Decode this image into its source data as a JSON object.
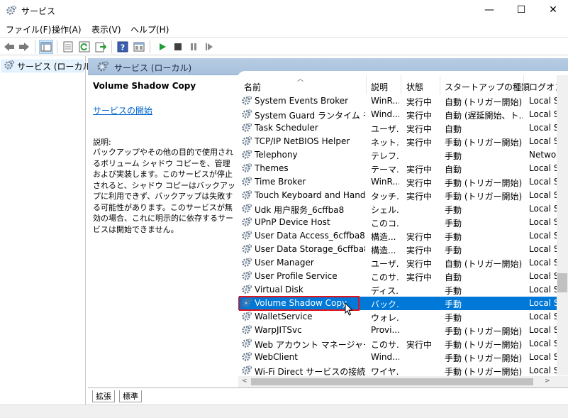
{
  "window": {
    "title": "サービス",
    "buttons": {
      "minimize": "—",
      "maximize": "☐",
      "close": "✕"
    }
  },
  "menu": [
    "ファイル(F)",
    "操作(A)",
    "表示(V)",
    "ヘルプ(H)"
  ],
  "tree": {
    "item": "サービス (ローカル)"
  },
  "panel": {
    "header": "サービス (ローカル)",
    "selected_title": "Volume Shadow Copy",
    "start_link": "サービスの開始",
    "desc_label": "説明:",
    "description": "バックアップやその他の目的で使用されるボリューム シャドウ コピーを、管理および実装します。このサービスが停止されると、シャドウ コピーはバックアップに利用できず、バックアップは失敗する可能性があります。このサービスが無効の場合、これに明示的に依存するサービスは開始できません。"
  },
  "columns": [
    "名前",
    "説明",
    "状態",
    "スタートアップの種類",
    "ログオン"
  ],
  "rows": [
    {
      "name": "System Events Broker",
      "desc": "WinR...",
      "status": "実行中",
      "startup": "自動 (トリガー開始)",
      "logon": "Local S"
    },
    {
      "name": "System Guard ランタイム モニ...",
      "desc": "Wind...",
      "status": "実行中",
      "startup": "自動 (遅延開始、ト...",
      "logon": "Local S"
    },
    {
      "name": "Task Scheduler",
      "desc": "ユーザ...",
      "status": "実行中",
      "startup": "自動",
      "logon": "Local S"
    },
    {
      "name": "TCP/IP NetBIOS Helper",
      "desc": "ネット...",
      "status": "実行中",
      "startup": "手動 (トリガー開始)",
      "logon": "Local S"
    },
    {
      "name": "Telephony",
      "desc": "テレフ...",
      "status": "",
      "startup": "手動",
      "logon": "Networ"
    },
    {
      "name": "Themes",
      "desc": "テーマ...",
      "status": "実行中",
      "startup": "自動",
      "logon": "Local S"
    },
    {
      "name": "Time Broker",
      "desc": "WinR...",
      "status": "実行中",
      "startup": "手動 (トリガー開始)",
      "logon": "Local S"
    },
    {
      "name": "Touch Keyboard and Hand...",
      "desc": "タッチ...",
      "status": "実行中",
      "startup": "手動 (トリガー開始)",
      "logon": "Local S"
    },
    {
      "name": "Udk 用户服务_6cffba8",
      "desc": "シェル...",
      "status": "",
      "startup": "手動",
      "logon": "Local S"
    },
    {
      "name": "UPnP Device Host",
      "desc": "このコ...",
      "status": "",
      "startup": "手動",
      "logon": "Local S"
    },
    {
      "name": "User Data Access_6cffba8",
      "desc": "構造...",
      "status": "実行中",
      "startup": "手動",
      "logon": "Local S"
    },
    {
      "name": "User Data Storage_6cffba8",
      "desc": "構造...",
      "status": "実行中",
      "startup": "手動",
      "logon": "Local S"
    },
    {
      "name": "User Manager",
      "desc": "ユーザ...",
      "status": "実行中",
      "startup": "自動 (トリガー開始)",
      "logon": "Local S"
    },
    {
      "name": "User Profile Service",
      "desc": "このサ...",
      "status": "実行中",
      "startup": "自動",
      "logon": "Local S"
    },
    {
      "name": "Virtual Disk",
      "desc": "ディス...",
      "status": "",
      "startup": "手動",
      "logon": "Local S"
    },
    {
      "name": "Volume Shadow Copy",
      "desc": "バック...",
      "status": "",
      "startup": "手動",
      "logon": "Local S"
    },
    {
      "name": "WalletService",
      "desc": "ウォレ...",
      "status": "",
      "startup": "手動",
      "logon": "Local S"
    },
    {
      "name": "WarpJITSvc",
      "desc": "Provi...",
      "status": "",
      "startup": "手動 (トリガー開始)",
      "logon": "Local S"
    },
    {
      "name": "Web アカウント マネージャー",
      "desc": "このサ...",
      "status": "実行中",
      "startup": "手動 (トリガー開始)",
      "logon": "Local S"
    },
    {
      "name": "WebClient",
      "desc": "Wind...",
      "status": "",
      "startup": "手動 (トリガー開始)",
      "logon": "Local S"
    },
    {
      "name": "Wi-Fi Direct サービスの接続マ...",
      "desc": "ワイヤ...",
      "status": "",
      "startup": "手動 (トリガー開始)",
      "logon": "Local S"
    }
  ],
  "selected_index": 15,
  "tabs": [
    "拡張",
    "標準"
  ],
  "colors": {
    "selection": "#0078d7",
    "highlight_outline": "#e0141e",
    "header": "#b7cde4"
  }
}
